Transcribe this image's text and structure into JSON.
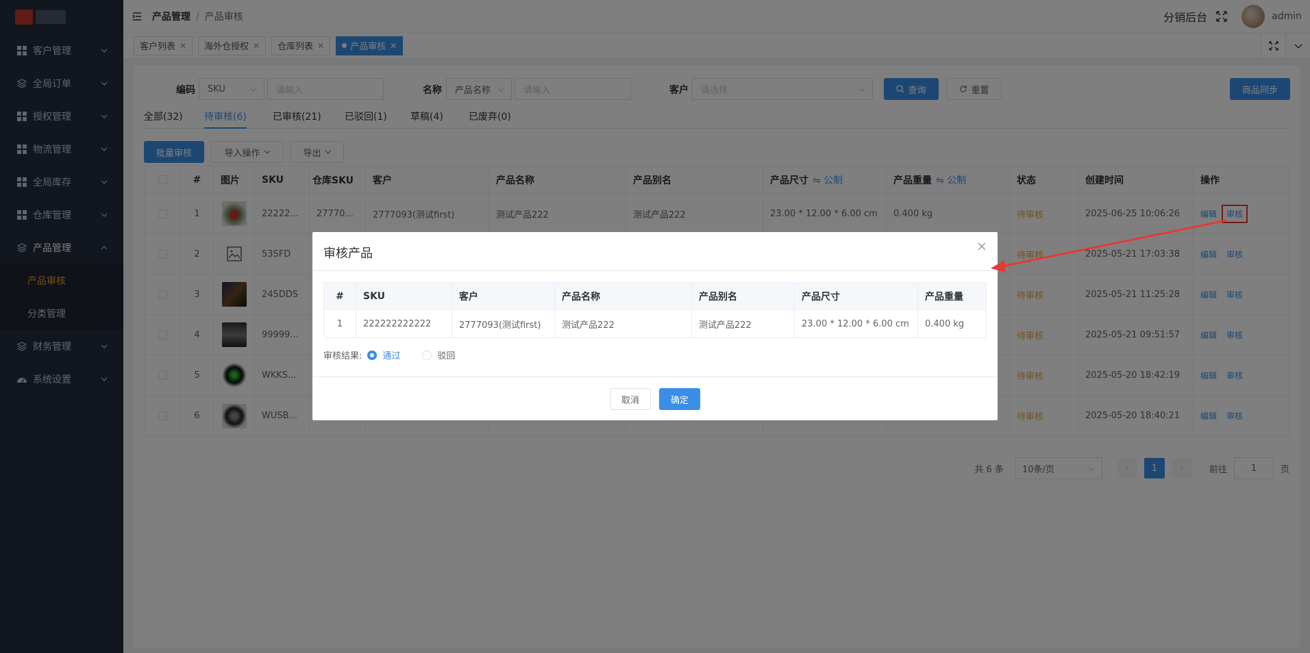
{
  "sidebar": {
    "items": [
      {
        "label": "客户管理",
        "icon": "grid-icon"
      },
      {
        "label": "全局订单",
        "icon": "layers-icon"
      },
      {
        "label": "授权管理",
        "icon": "grid-icon"
      },
      {
        "label": "物流管理",
        "icon": "grid-icon"
      },
      {
        "label": "全局库存",
        "icon": "grid-icon"
      },
      {
        "label": "仓库管理",
        "icon": "grid-icon"
      },
      {
        "label": "产品管理",
        "icon": "layers-icon"
      },
      {
        "label": "财务管理",
        "icon": "layers-icon"
      },
      {
        "label": "系统设置",
        "icon": "dashboard-icon"
      }
    ],
    "sub_items": [
      "产品审核",
      "分类管理"
    ]
  },
  "header": {
    "breadcrumb_parent": "产品管理",
    "breadcrumb_sep": "/",
    "breadcrumb_current": "产品审核",
    "app_title": "分销后台",
    "username": "admin"
  },
  "tags": [
    "客户列表",
    "海外仓授权",
    "仓库列表",
    "产品审核"
  ],
  "filter": {
    "code_label": "编码",
    "code_type": "SKU",
    "code_placeholder": "请输入",
    "name_label": "名称",
    "name_type": "产品名称",
    "name_placeholder": "请输入",
    "customer_label": "客户",
    "customer_placeholder": "请选择",
    "search_btn": "查询",
    "reset_btn": "重置",
    "sync_btn": "商品同步"
  },
  "status_tabs": [
    "全部(32)",
    "待审核(6)",
    "已审核(21)",
    "已驳回(1)",
    "草稿(4)",
    "已废弃(0)"
  ],
  "actions": {
    "batch": "批量审核",
    "import": "导入操作",
    "export": "导出"
  },
  "table": {
    "headers": [
      "#",
      "图片",
      "SKU",
      "仓库SKU",
      "客户",
      "产品名称",
      "产品别名",
      "产品尺寸",
      "产品重量",
      "状态",
      "创建时间",
      "操作"
    ],
    "metric_label": "公制",
    "rows": [
      {
        "no": "1",
        "sku": "22222...",
        "wsku": "27770...",
        "customer": "2777093(测试first)",
        "name": "测试产品222",
        "alias": "测试产品222",
        "size": "23.00 * 12.00 * 6.00 cm",
        "weight": "0.400 kg",
        "status": "待审核",
        "time": "2025-06-25 10:06:26"
      },
      {
        "no": "2",
        "sku": "53SFD",
        "wsku": "",
        "customer": "",
        "name": "",
        "alias": "",
        "size": "",
        "weight": "",
        "status": "待审核",
        "time": "2025-05-21 17:03:38"
      },
      {
        "no": "3",
        "sku": "245DDS",
        "wsku": "",
        "customer": "",
        "name": "",
        "alias": "",
        "size": "",
        "weight": "",
        "status": "待审核",
        "time": "2025-05-21 11:25:28"
      },
      {
        "no": "4",
        "sku": "99999...",
        "wsku": "",
        "customer": "",
        "name": "",
        "alias": "",
        "size": "",
        "weight": "",
        "status": "待审核",
        "time": "2025-05-21 09:51:57"
      },
      {
        "no": "5",
        "sku": "WKKS...",
        "wsku": "",
        "customer": "",
        "name": "",
        "alias": "",
        "size": "",
        "weight": "",
        "status": "待审核",
        "time": "2025-05-20 18:42:19"
      },
      {
        "no": "6",
        "sku": "WUSB...",
        "wsku": "",
        "customer": "",
        "name": "",
        "alias": "",
        "size": "",
        "weight": "",
        "status": "待审核",
        "time": "2025-05-20 18:40:21"
      }
    ],
    "edit_label": "编辑",
    "review_label": "审核"
  },
  "pager": {
    "total": "共 6 条",
    "size": "10条/页",
    "page": "1",
    "goto": "前往",
    "goto_value": "1",
    "page_unit": "页"
  },
  "dialog": {
    "title": "审核产品",
    "headers": [
      "#",
      "SKU",
      "客户",
      "产品名称",
      "产品别名",
      "产品尺寸",
      "产品重量"
    ],
    "row": {
      "no": "1",
      "sku": "222222222222",
      "customer": "2777093(测试first)",
      "name": "测试产品222",
      "alias": "测试产品222",
      "size": "23.00 * 12.00 * 6.00 cm",
      "weight": "0.400 kg"
    },
    "result_label": "审核结果:",
    "approve": "通过",
    "reject": "驳回",
    "cancel": "取消",
    "confirm": "确定"
  },
  "colors": {
    "primary": "#3a8ee6",
    "warning": "#e6a23c",
    "highlight": "#e53935",
    "sidebar": "#252d3e"
  }
}
